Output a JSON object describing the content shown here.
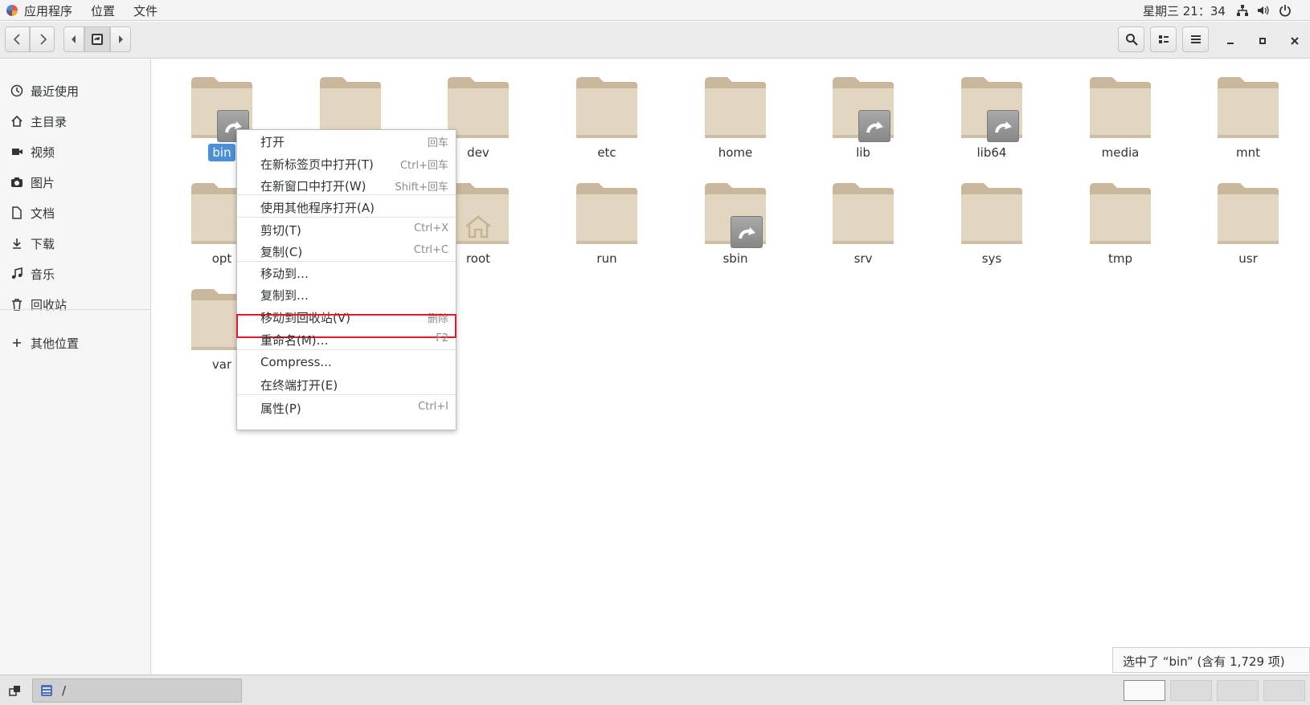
{
  "topbar": {
    "apps": "应用程序",
    "places": "位置",
    "files": "文件",
    "clock": "星期三 21：34",
    "icons": [
      "network-icon",
      "volume-icon",
      "power-icon"
    ]
  },
  "header": {
    "path": "/",
    "buttons": [
      "back-icon",
      "forward-icon",
      "path-left-icon",
      "root-icon",
      "path-right-icon",
      "search-icon",
      "view-icon",
      "menu-icon",
      "minimize-icon",
      "maximize-icon",
      "close-icon"
    ]
  },
  "sidebar": {
    "items": [
      {
        "label": "最近使用",
        "icon": "recent-icon"
      },
      {
        "label": "主目录",
        "icon": "home-icon"
      },
      {
        "label": "视频",
        "icon": "video-icon"
      },
      {
        "label": "图片",
        "icon": "camera-icon"
      },
      {
        "label": "文档",
        "icon": "document-icon"
      },
      {
        "label": "下载",
        "icon": "download-icon"
      },
      {
        "label": "音乐",
        "icon": "music-icon"
      },
      {
        "label": "回收站",
        "icon": "trash-icon"
      },
      {
        "label": "其他位置",
        "icon": "plus-icon"
      }
    ]
  },
  "files": [
    {
      "name": "bin",
      "symlink": true,
      "selected": true
    },
    {
      "name": "",
      "symlink": false
    },
    {
      "name": "dev",
      "symlink": false
    },
    {
      "name": "etc",
      "symlink": false
    },
    {
      "name": "home",
      "symlink": false
    },
    {
      "name": "lib",
      "symlink": true
    },
    {
      "name": "lib64",
      "symlink": true
    },
    {
      "name": "media",
      "symlink": false
    },
    {
      "name": "mnt",
      "symlink": false
    },
    {
      "name": "opt",
      "symlink": false
    },
    {
      "name": "",
      "symlink": false
    },
    {
      "name": "root",
      "symlink": false,
      "home_emblem": true
    },
    {
      "name": "run",
      "symlink": false
    },
    {
      "name": "sbin",
      "symlink": true
    },
    {
      "name": "srv",
      "symlink": false
    },
    {
      "name": "sys",
      "symlink": false
    },
    {
      "name": "tmp",
      "symlink": false
    },
    {
      "name": "usr",
      "symlink": false
    },
    {
      "name": "var",
      "symlink": false
    }
  ],
  "context_menu": {
    "items": [
      {
        "label": "打开",
        "shortcut": "回车"
      },
      {
        "label": "在新标签页中打开(T)",
        "shortcut": "Ctrl+回车"
      },
      {
        "label": "在新窗口中打开(W)",
        "shortcut": "Shift+回车"
      },
      {
        "label": "使用其他程序打开(A)",
        "shortcut": ""
      },
      {
        "label": "剪切(T)",
        "shortcut": "Ctrl+X"
      },
      {
        "label": "复制(C)",
        "shortcut": "Ctrl+C"
      },
      {
        "label": "移动到…",
        "shortcut": ""
      },
      {
        "label": "复制到…",
        "shortcut": ""
      },
      {
        "label": "移动到回收站(V)",
        "shortcut": "删除",
        "highlighted": true
      },
      {
        "label": "重命名(M)…",
        "shortcut": "F2"
      },
      {
        "label": "Compress...",
        "shortcut": ""
      },
      {
        "label": "在终端打开(E)",
        "shortcut": ""
      },
      {
        "label": "属性(P)",
        "shortcut": "Ctrl+I"
      }
    ]
  },
  "status": "选中了 “bin” (含有 1,729 项)",
  "taskbar": {
    "window_title": "/",
    "workspaces": 4
  },
  "colors": {
    "folder": "#e3d6c0",
    "folder_tab": "#c9b89c",
    "selection": "#4a90d9",
    "highlight_border": "#e0182d"
  }
}
